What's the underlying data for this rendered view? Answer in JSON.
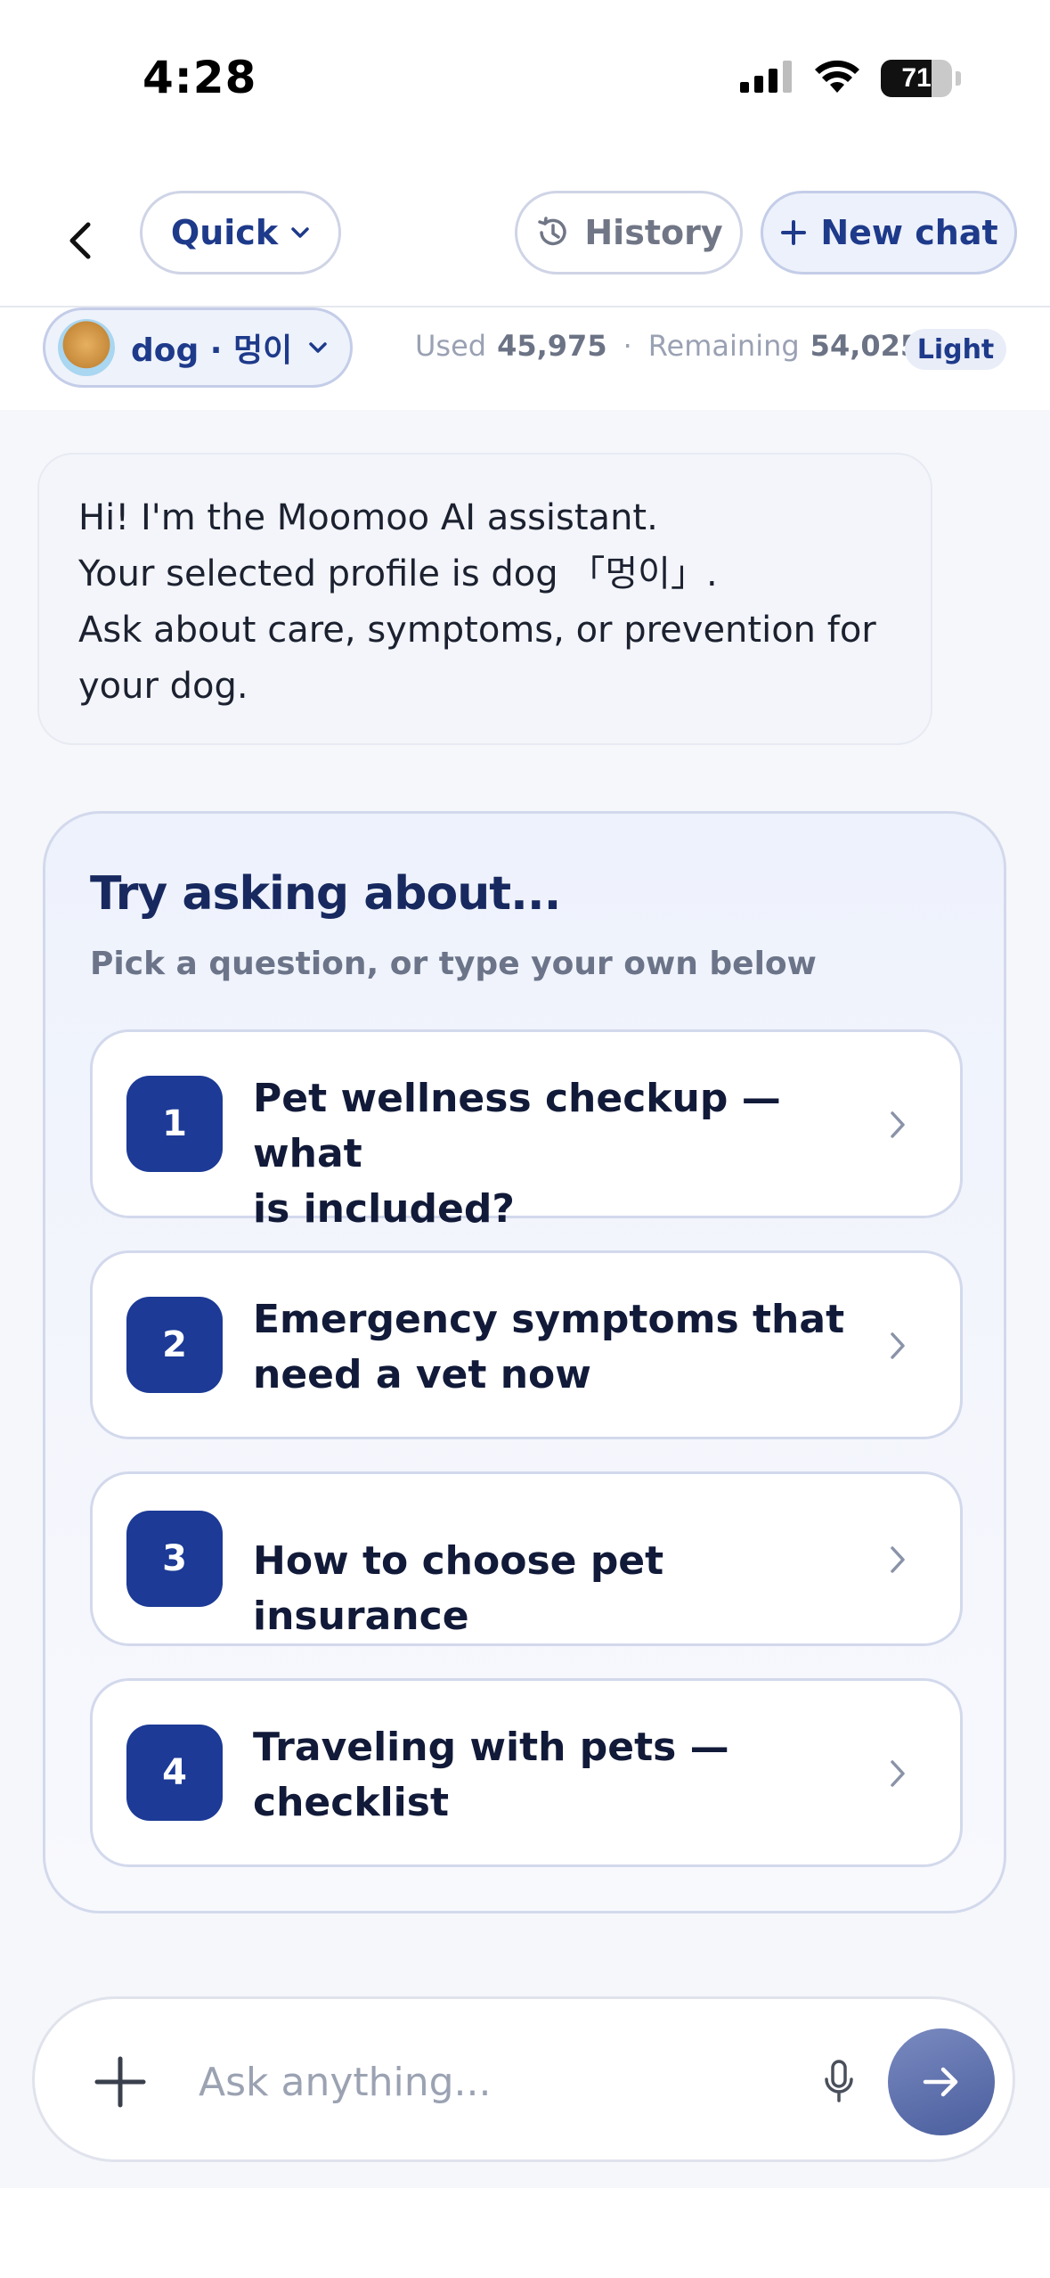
{
  "status_bar": {
    "time": "4:28",
    "battery_level": "71",
    "icons": [
      "cellular-signal-icon",
      "wifi-icon",
      "battery-icon"
    ]
  },
  "top_bar": {
    "mode_label": "Quick",
    "history_label": "History",
    "new_chat_label": "New chat",
    "icons": [
      "chevron-left-icon",
      "chevron-down-icon",
      "history-clock-icon",
      "plus-icon"
    ]
  },
  "profile": {
    "name": "dog · 멍이",
    "used_label": "Used",
    "used_value": "45,975",
    "separator": "·",
    "remaining_label": "Remaining",
    "remaining_value": "54,025",
    "plan_badge": "Light"
  },
  "assistant_message": {
    "lines": [
      "Hi! I'm the Moomoo AI assistant.",
      "Your selected profile is dog 「멍이」.",
      "Ask about care, symptoms, or prevention for",
      "your dog."
    ]
  },
  "suggestions": {
    "title": "Try asking about...",
    "subtitle": "Pick a question, or type your own below",
    "items": [
      {
        "number": "1",
        "lines": [
          "Pet wellness checkup — what",
          "is included?"
        ]
      },
      {
        "number": "2",
        "lines": [
          "Emergency symptoms that",
          "need a vet now"
        ]
      },
      {
        "number": "3",
        "lines": [
          "How to choose pet insurance"
        ]
      },
      {
        "number": "4",
        "lines": [
          "Traveling with pets —",
          "checklist"
        ]
      }
    ]
  },
  "composer": {
    "placeholder": "Ask anything...",
    "icons": [
      "plus-icon",
      "microphone-icon",
      "arrow-right-icon"
    ]
  },
  "colors": {
    "accent": "#1c3a96",
    "accent_text": "#1e3a8a",
    "chat_background": "#f6f7fb",
    "send_button": "#5a6ca8"
  }
}
